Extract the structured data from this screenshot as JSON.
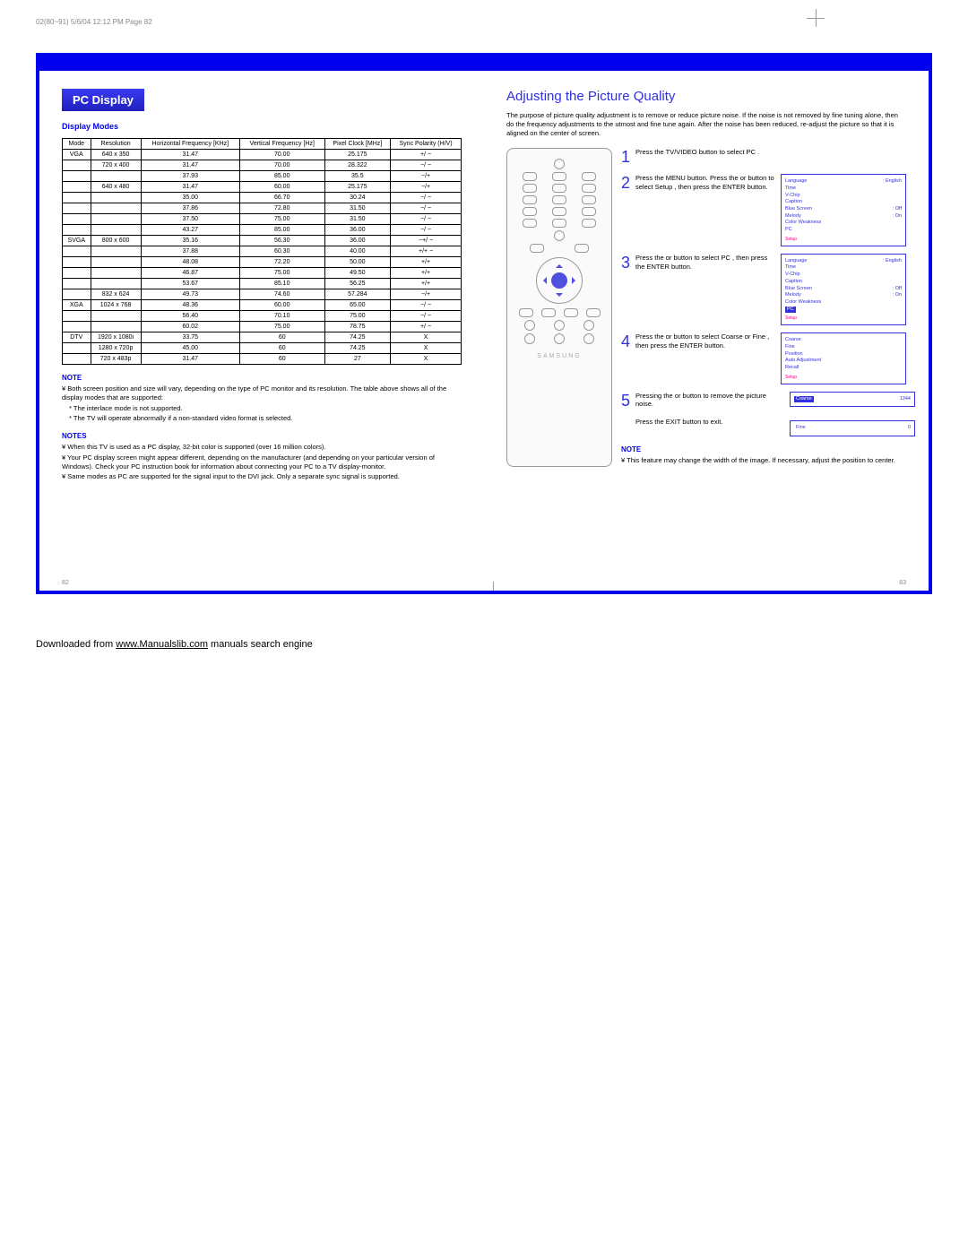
{
  "hdr": "02(80~91)  5/6/04  12:12 PM  Page 82",
  "tab": "PC Display",
  "sub": "Display Modes",
  "th": [
    "Mode",
    "Resolution",
    "Horizontal Frequency [KHz]",
    "Vertical Frequency [Hz]",
    "Pixel Clock [MHz]",
    "Sync Polarity (H/V)"
  ],
  "rows": [
    [
      "VGA",
      "640 x 350",
      "31.47",
      "70.00",
      "25.175",
      "+/ −"
    ],
    [
      "",
      "720 x 400",
      "31.47",
      "70.00",
      "28.322",
      "−/ −"
    ],
    [
      "",
      "",
      "37.93",
      "85.00",
      "35.5",
      "−/+"
    ],
    [
      "",
      "640 x 480",
      "31.47",
      "60.00",
      "25.175",
      "−/+"
    ],
    [
      "",
      "",
      "35.00",
      "66.70",
      "30.24",
      "−/ −"
    ],
    [
      "",
      "",
      "37.86",
      "72.80",
      "31.50",
      "−/ −"
    ],
    [
      "",
      "",
      "37.50",
      "75.00",
      "31.50",
      "−/ −"
    ],
    [
      "",
      "",
      "43.27",
      "85.00",
      "36.00",
      "−/ −"
    ],
    [
      "SVGA",
      "800 x 600",
      "35.16",
      "56.30",
      "36.00",
      "−+/ −"
    ],
    [
      "",
      "",
      "37.88",
      "60.30",
      "40.00",
      "+/+ −"
    ],
    [
      "",
      "",
      "48.08",
      "72.20",
      "50.00",
      "+/+"
    ],
    [
      "",
      "",
      "46.87",
      "75.00",
      "49.50",
      "+/+"
    ],
    [
      "",
      "",
      "53.67",
      "85.10",
      "56.25",
      "+/+"
    ],
    [
      "",
      "832 x 624",
      "49.73",
      "74.60",
      "57.284",
      "−/+"
    ],
    [
      "XGA",
      "1024 x 768",
      "48.36",
      "60.00",
      "65.00",
      "−/ −"
    ],
    [
      "",
      "",
      "56.40",
      "70.10",
      "75.00",
      "−/ −"
    ],
    [
      "",
      "",
      "60.02",
      "75.00",
      "78.75",
      "+/ −"
    ],
    [
      "DTV",
      "1920 x 1080i",
      "33.75",
      "60",
      "74.25",
      "X"
    ],
    [
      "",
      "1280 x 720p",
      "45.00",
      "60",
      "74.25",
      "X"
    ],
    [
      "",
      "720 x 483p",
      "31.47",
      "60",
      "27",
      "X"
    ]
  ],
  "note1_hdr": "NOTE",
  "note1_1": "Both screen position and size will vary, depending on the type of PC monitor and its resolution. The table above shows all of the display modes that are supported:",
  "note1_2": "The interlace mode is not supported.",
  "note1_3": "The TV will operate abnormally if a non-standard video format is selected.",
  "notes_hdr": "NOTES",
  "notes_1": "When this TV is used as a PC display, 32-bit color is supported (over 16 million colors).",
  "notes_2": "Your PC display screen might appear different, depending on the manufacturer (and depending on your particular version of Windows). Check your PC instruction book for information about connecting your PC to a TV display-monitor.",
  "notes_3": "Same modes as PC are supported for the signal input to the DVI jack. Only a separate sync signal is supported.",
  "h2": "Adjusting the Picture Quality",
  "intro": "The purpose of picture quality adjustment is to remove or reduce picture noise. If the noise is not removed by fine tuning alone, then do the frequency adjustments to the utmost and fine tune again. After the noise has been reduced, re-adjust the picture so that it is aligned on the center of screen.",
  "s1": "Press the TV/VIDEO button to select  PC .",
  "s2": "Press the MENU button. Press the    or    button to select  Setup , then press the ENTER button.",
  "s3": "Press the    or    button to select  PC , then press the ENTER button.",
  "s4": "Press the    or    button to select  Coarse  or  Fine , then press the ENTER button.",
  "s5a": "Pressing the    or    button to remove the picture noise.",
  "s5b": "Press the EXIT button to exit.",
  "rnote_hdr": "NOTE",
  "rnote": "This feature may change the width of the image. If necessary, adjust the position to center.",
  "osd1": [
    [
      "Language",
      ": English"
    ],
    [
      "Time",
      ""
    ],
    [
      "V-Chip",
      ""
    ],
    [
      "Caption",
      ""
    ],
    [
      "Blue Screen",
      ": Off"
    ],
    [
      "Melody",
      ": On"
    ],
    [
      "Color Weakness",
      ""
    ],
    [
      "PC",
      ""
    ]
  ],
  "osd2": [
    [
      "Language",
      ": English"
    ],
    [
      "Time",
      ""
    ],
    [
      "V-Chip",
      ""
    ],
    [
      "Caption",
      ""
    ],
    [
      "Blue Screen",
      ": Off"
    ],
    [
      "Melody",
      ": On"
    ],
    [
      "Color Weakness",
      ""
    ]
  ],
  "osd2_hl": "PC",
  "osd3": [
    [
      "Coarse",
      ""
    ],
    [
      "Fine",
      ""
    ],
    [
      "Position",
      ""
    ],
    [
      "Auto Adjustment",
      ""
    ],
    [
      "Recall",
      ""
    ]
  ],
  "osd4_lbl": "Coarse",
  "osd4_val": "1344",
  "osd5_lbl": "Fine",
  "osd5_val": "0",
  "setup_lbl": "Setup",
  "brand": "SAMSUNG",
  "pg_l": "82",
  "pg_r": "83",
  "foot_a": "Downloaded from ",
  "foot_b": "www.Manualslib.com",
  "foot_c": " manuals search engine"
}
